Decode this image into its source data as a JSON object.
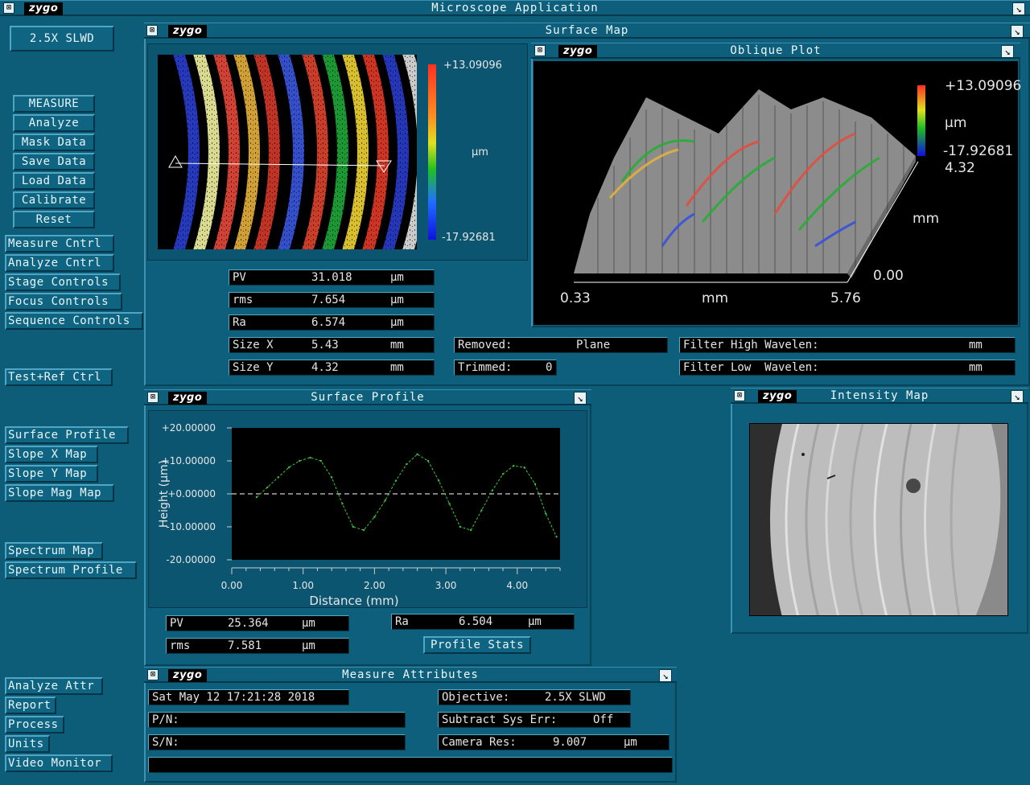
{
  "app": {
    "logo": "zygo",
    "title": "Microscope  Application"
  },
  "objective_button": "2.5X SLWD",
  "side_menu": {
    "top": [
      "MEASURE",
      "Analyze",
      "Mask Data",
      "Save Data",
      "Load Data",
      "Calibrate",
      "Reset"
    ],
    "controls": [
      "Measure Cntrl",
      "Analyze Cntrl",
      "Stage Controls",
      "Focus Controls",
      "Sequence Controls"
    ],
    "testref": "Test+Ref Ctrl",
    "maps": [
      "Surface Profile",
      "Slope X Map",
      "Slope Y Map",
      "Slope Mag Map"
    ],
    "spectrum": [
      "Spectrum Map",
      "Spectrum Profile"
    ],
    "bottom": [
      "Analyze Attr",
      "Report",
      "Process",
      "Units",
      "Video Monitor"
    ]
  },
  "surface_map": {
    "title": "Surface Map",
    "scale_max": "+13.09096",
    "scale_min": "-17.92681",
    "scale_unit": "µm",
    "stats": [
      {
        "label": "PV",
        "value": "31.018",
        "unit": "µm"
      },
      {
        "label": "rms",
        "value": "7.654",
        "unit": "µm"
      },
      {
        "label": "Ra",
        "value": "6.574",
        "unit": "µm"
      },
      {
        "label": "Size X",
        "value": "5.43",
        "unit": "mm"
      },
      {
        "label": "Size Y",
        "value": "4.32",
        "unit": "mm"
      }
    ],
    "removed_label": "Removed:",
    "removed_value": "Plane",
    "trimmed_label": "Trimmed:",
    "trimmed_value": "0",
    "filter_high_label": "Filter High Wavelen:",
    "filter_high_unit": "mm",
    "filter_low_label": "Filter Low  Wavelen:",
    "filter_low_unit": "mm"
  },
  "oblique_plot": {
    "title": "Oblique Plot",
    "scale_max": "+13.09096",
    "scale_unit": "µm",
    "scale_min": "-17.92681",
    "y_max": "4.32",
    "y_unit": "mm",
    "y_min": "0.00",
    "x_min": "0.33",
    "x_unit": "mm",
    "x_max": "5.76"
  },
  "surface_profile": {
    "title": "Surface Profile",
    "stats_left": [
      {
        "label": "PV",
        "value": "25.364",
        "unit": "µm"
      },
      {
        "label": "rms",
        "value": "7.581",
        "unit": "µm"
      }
    ],
    "stats_right": {
      "label": "Ra",
      "value": "6.504",
      "unit": "µm"
    },
    "stats_button": "Profile Stats"
  },
  "chart_data": {
    "type": "line",
    "title": "",
    "xlabel": "Distance (mm)",
    "ylabel": "Height (µm)",
    "xlim": [
      0,
      4.6
    ],
    "ylim": [
      -20,
      20
    ],
    "x_ticks": [
      "0.00",
      "1.00",
      "2.00",
      "3.00",
      "4.00"
    ],
    "y_ticks": [
      "+20.00000",
      "+10.00000",
      "+0.00000",
      "-10.00000",
      "-20.00000"
    ],
    "series": [
      {
        "color": "#3cc43c",
        "x": [
          0.35,
          0.5,
          0.65,
          0.8,
          0.95,
          1.1,
          1.25,
          1.4,
          1.55,
          1.7,
          1.85,
          2.0,
          2.15,
          2.3,
          2.45,
          2.6,
          2.75,
          2.9,
          3.05,
          3.2,
          3.35,
          3.5,
          3.65,
          3.8,
          3.95,
          4.1,
          4.25,
          4.4,
          4.55
        ],
        "y": [
          -1,
          2,
          5,
          8,
          10,
          11,
          10,
          5,
          -3,
          -10,
          -11,
          -7,
          -2,
          4,
          9,
          12,
          10,
          4,
          -3,
          -10,
          -11,
          -5,
          1,
          6,
          8.5,
          8,
          3,
          -6,
          -13
        ]
      }
    ]
  },
  "intensity_map": {
    "title": "Intensity Map"
  },
  "measure_attributes": {
    "title": "Measure Attributes",
    "date": "Sat May 12 17:21:28 2018",
    "pn_label": "P/N:",
    "sn_label": "S/N:",
    "objective_label": "Objective:",
    "objective_value": "2.5X SLWD",
    "subtract_label": "Subtract Sys Err:",
    "subtract_value": "Off",
    "camera_label": "Camera Res:",
    "camera_value": "9.007",
    "camera_unit": "µm"
  }
}
